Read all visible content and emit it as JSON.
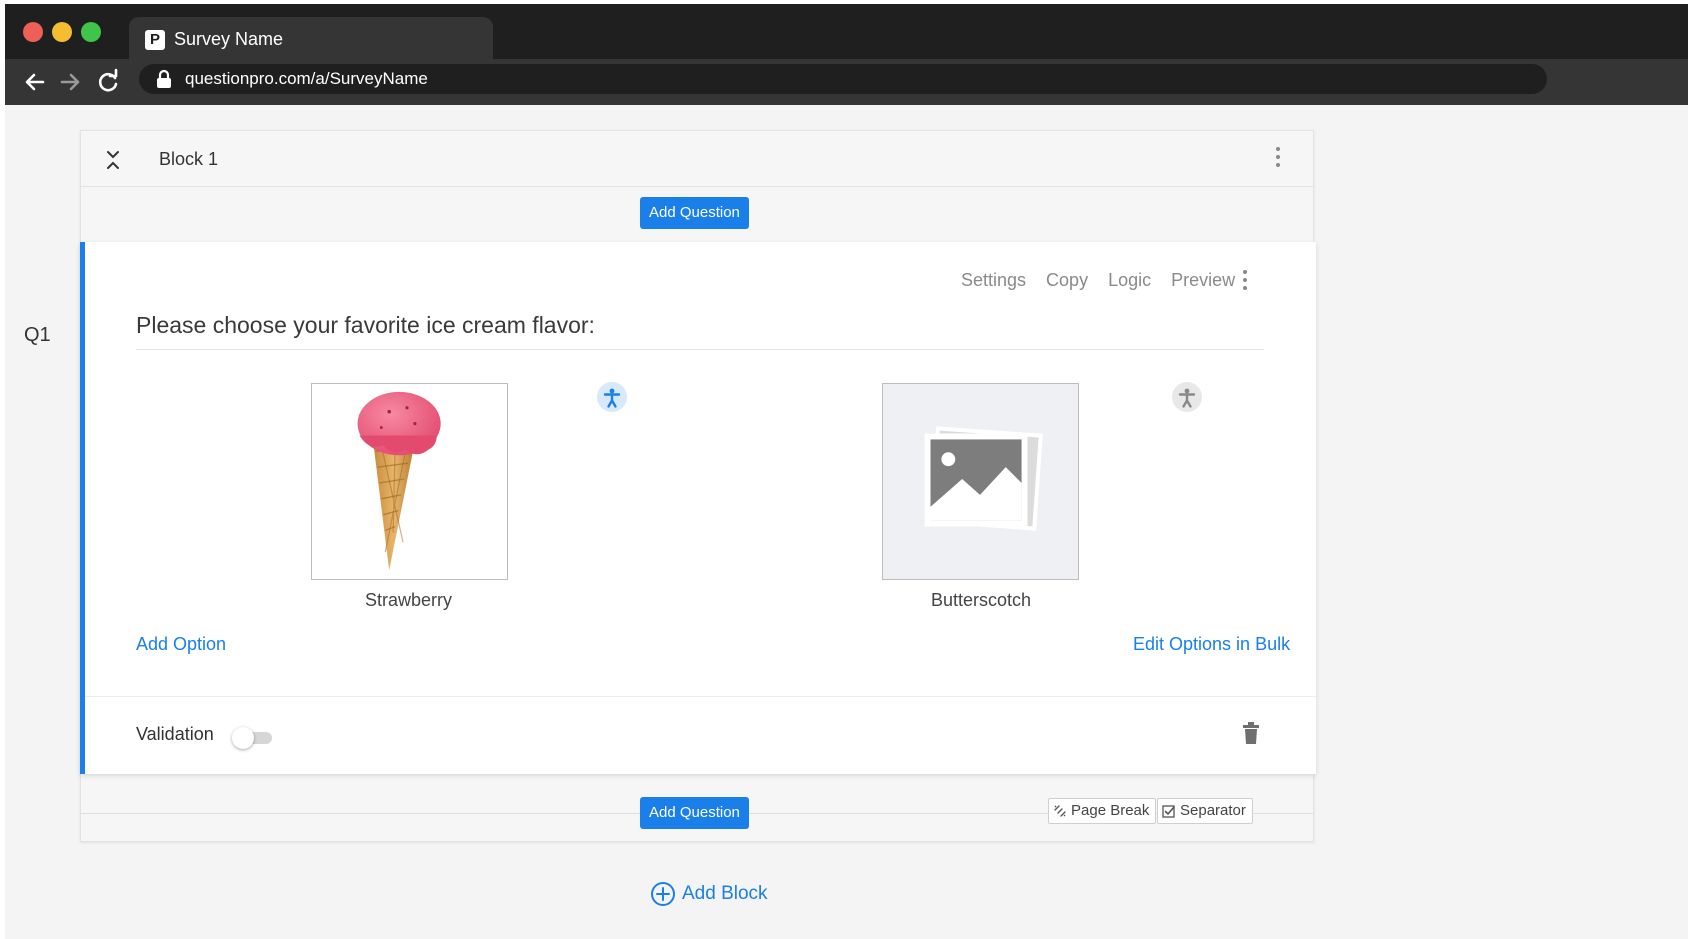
{
  "browser": {
    "tab_title": "Survey Name",
    "favicon_letter": "P",
    "url": "questionpro.com/a/SurveyName",
    "icons": [
      "back-arrow-icon",
      "forward-arrow-icon",
      "reload-icon",
      "lock-icon"
    ]
  },
  "block": {
    "title": "Block 1",
    "add_question_label": "Add Question"
  },
  "question": {
    "number": "Q1",
    "text": "Please choose your favorite ice cream flavor:",
    "tools": [
      "Settings",
      "Copy",
      "Logic",
      "Preview"
    ],
    "options": [
      {
        "label": "Strawberry",
        "image": "ice-cream-cone-image"
      },
      {
        "label": "Butterscotch",
        "image": "image-placeholder-icon"
      }
    ],
    "add_option_label": "Add Option",
    "edit_bulk_label": "Edit Options in Bulk",
    "validation_label": "Validation",
    "validation_on": false
  },
  "footer": {
    "add_question_label": "Add Question",
    "page_break_label": "Page Break",
    "separator_label": "Separator"
  },
  "add_block_label": "Add Block",
  "colors": {
    "accent": "#1a7fe8",
    "chrome_dark": "#1f1f1f",
    "chrome_mid": "#353535",
    "traffic_red": "#ed5f57",
    "traffic_yellow": "#f5bd30",
    "traffic_green": "#3fc64a"
  }
}
